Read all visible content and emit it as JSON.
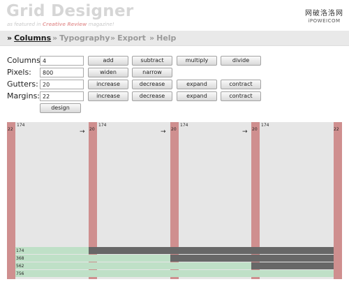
{
  "header": {
    "title": "Grid Designer",
    "subtitle_prefix": "as featured in ",
    "subtitle_magazine": "Creative Review",
    "subtitle_suffix": " magazine!"
  },
  "watermark": {
    "line1": "网破洛洛网",
    "line2": "iPOWEICOM"
  },
  "nav": {
    "chevron": "»",
    "items": [
      "Columns",
      "Typography",
      "Export",
      "Help"
    ],
    "active": "Columns"
  },
  "form": {
    "columns": {
      "label": "Columns:",
      "value": "4",
      "buttons": [
        "add",
        "subtract",
        "multiply",
        "divide"
      ]
    },
    "pixels": {
      "label": "Pixels:",
      "value": "800",
      "buttons": [
        "widen",
        "narrow"
      ]
    },
    "gutters": {
      "label": "Gutters:",
      "value": "20",
      "buttons": [
        "increase",
        "decrease",
        "expand",
        "contract"
      ]
    },
    "margins": {
      "label": "Margins:",
      "value": "22",
      "buttons": [
        "increase",
        "decrease",
        "expand",
        "contract"
      ]
    },
    "design_button": "design"
  },
  "grid": {
    "margin_left": "22",
    "margin_right": "22",
    "column_labels": [
      "174",
      "174",
      "174",
      "174"
    ],
    "gutter_labels": [
      "20",
      "20",
      "20"
    ],
    "gutter_arrow": "→",
    "spans": [
      "174",
      "368",
      "562",
      "756"
    ],
    "colors": {
      "margin": "#cf8f8f",
      "gutter": "#cf8f8f",
      "column": "#e6e6e6",
      "span": "#bfe0c7",
      "rest": "#676767"
    }
  }
}
